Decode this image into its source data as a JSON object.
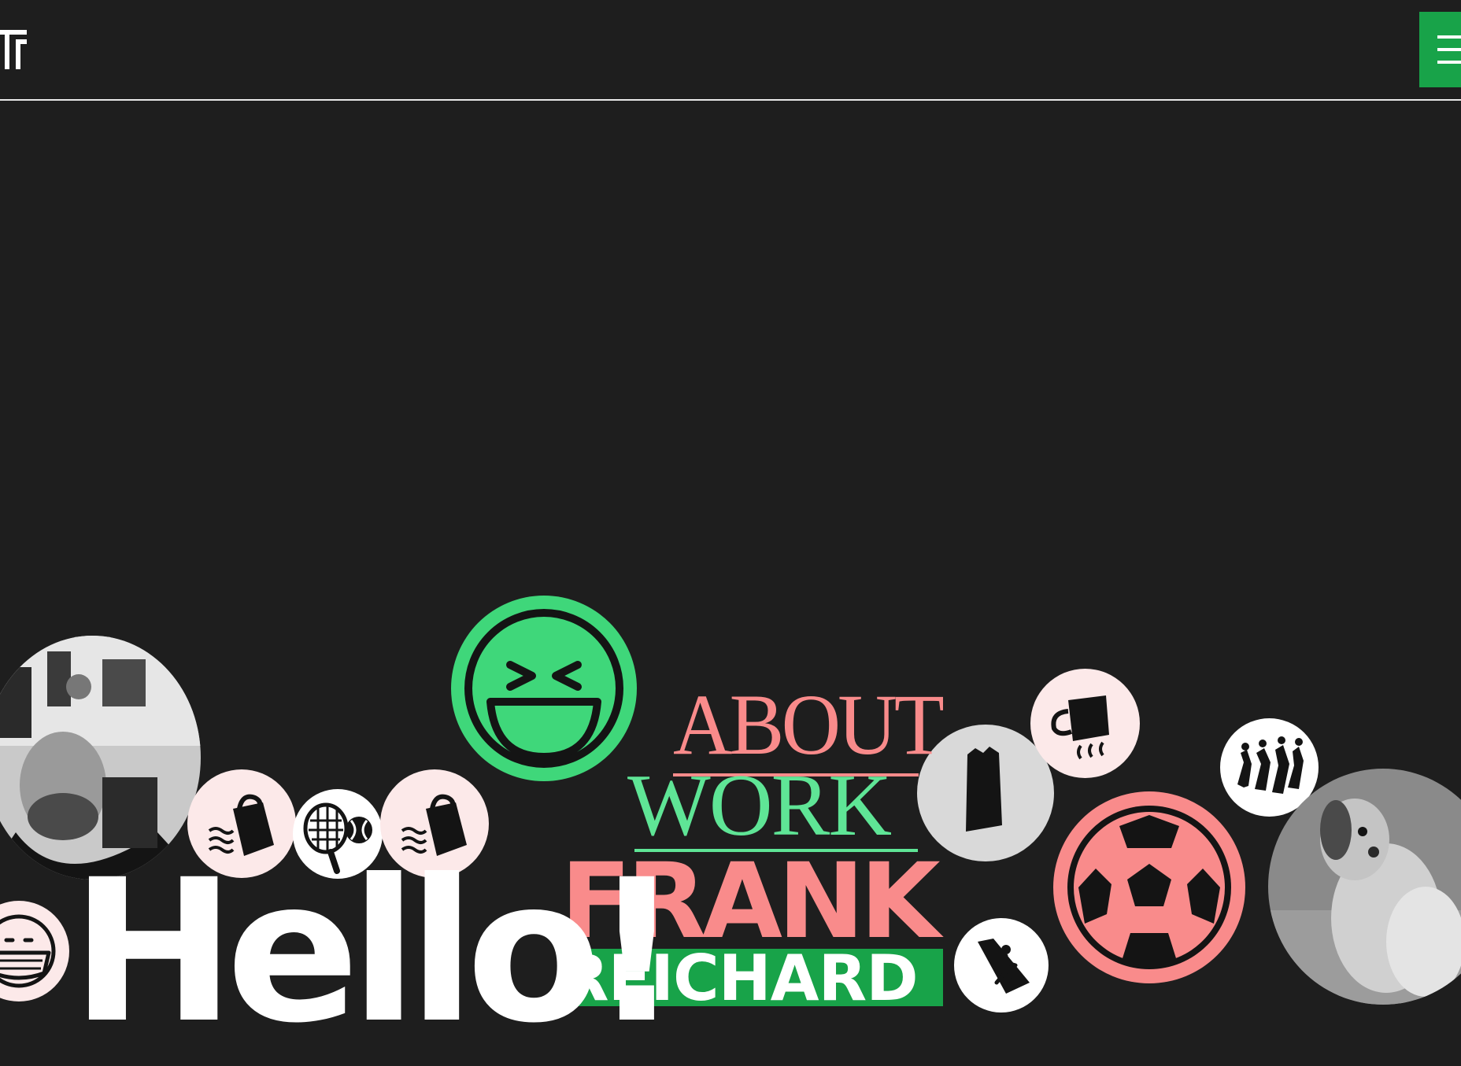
{
  "header": {
    "logo_icon": "fr-monogram-logo",
    "menu_icon": "hamburger-menu-icon",
    "menu_color": "#18a349"
  },
  "nav": {
    "about": "ABOUT",
    "work": "WORK"
  },
  "name": {
    "first": "FRANK",
    "last": "REICHARD"
  },
  "greeting": "Hello!",
  "colors": {
    "background": "#1e1e1e",
    "green": "#18a349",
    "mint": "#5fe596",
    "coral": "#f98b8b",
    "smiley": "#3fd77a"
  },
  "bubbles": [
    "portrait-photo",
    "laughing-face-icon",
    "shopping-bag-icon",
    "tennis-icon",
    "shopping-bag-icon",
    "face-mask-icon",
    "phone-booth-icon",
    "hot-mug-icon",
    "soccer-ball-icon",
    "dancing-people-icon",
    "escalator-icon",
    "dog-photo"
  ]
}
